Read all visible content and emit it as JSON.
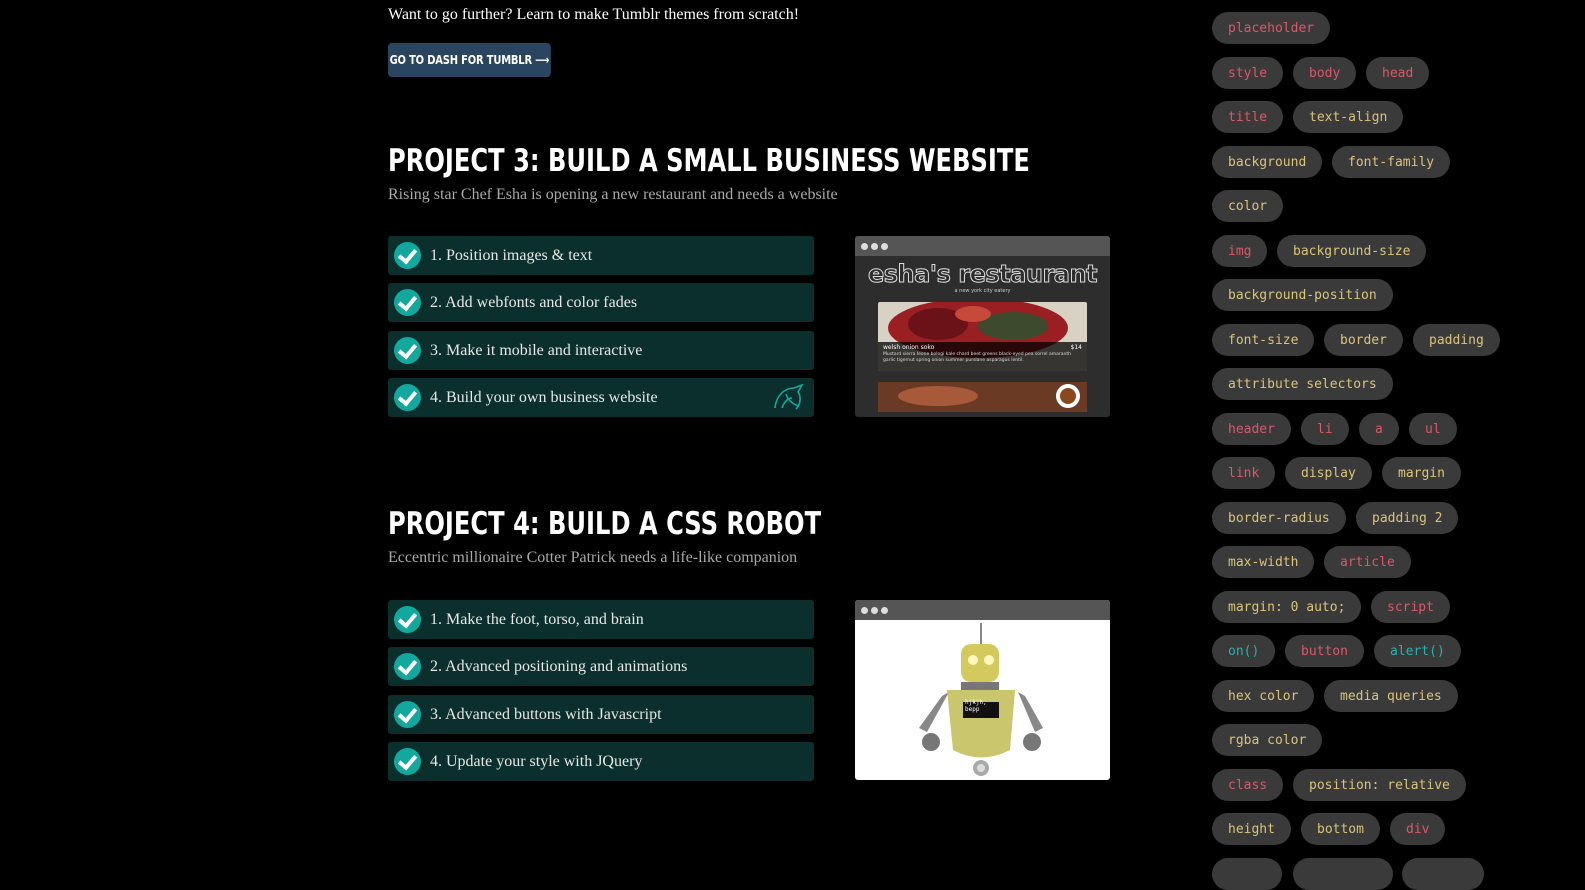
{
  "intro_text": "Want to go further? Learn to make Tumblr themes from scratch!",
  "dash_button": "GO TO DASH FOR TUMBLR ⟶",
  "projects": [
    {
      "title": "PROJECT 3: BUILD A SMALL BUSINESS WEBSITE",
      "subtitle": "Rising star Chef Esha is opening a new restaurant and needs a website",
      "lessons": [
        "1. Position images & text",
        "2. Add webfonts and color fades",
        "3. Make it mobile and interactive",
        "4. Build your own business website"
      ],
      "preview": {
        "heading": "esha's restaurant",
        "tagline": "a new york city eatery",
        "dish": "welsh onion soko",
        "price": "$14",
        "desc": "Mustard sierra leone bologi kale chard beet greens black-eyed pea sorrel amaranth garlic tigernut spring onion summer purslane asparagus lentil."
      }
    },
    {
      "title": "PROJECT 4: BUILD A CSS ROBOT",
      "subtitle": "Eccentric millionaire Cotter Patrick needs a life-like companion",
      "lessons": [
        "1. Make the foot, torso, and brain",
        "2. Advanced positioning and animations",
        "3. Advanced buttons with Javascript",
        "4. Update your style with JQuery"
      ],
      "preview": {
        "screen_text": "hjkjh, bepp"
      }
    }
  ],
  "tags": [
    {
      "label": "placeholder",
      "color": "red"
    },
    {
      "label": "style",
      "color": "red"
    },
    {
      "label": "body",
      "color": "red"
    },
    {
      "label": "head",
      "color": "red"
    },
    {
      "label": "title",
      "color": "red"
    },
    {
      "label": "text-align",
      "color": "yellow"
    },
    {
      "label": "background",
      "color": "yellow"
    },
    {
      "label": "font-family",
      "color": "yellow"
    },
    {
      "label": "color",
      "color": "yellow"
    },
    {
      "label": "img",
      "color": "red"
    },
    {
      "label": "background-size",
      "color": "yellow"
    },
    {
      "label": "background-position",
      "color": "yellow"
    },
    {
      "label": "font-size",
      "color": "yellow"
    },
    {
      "label": "border",
      "color": "yellow"
    },
    {
      "label": "padding",
      "color": "yellow"
    },
    {
      "label": "attribute selectors",
      "color": "yellow"
    },
    {
      "label": "header",
      "color": "red"
    },
    {
      "label": "li",
      "color": "red"
    },
    {
      "label": "a",
      "color": "red"
    },
    {
      "label": "ul",
      "color": "red"
    },
    {
      "label": "link",
      "color": "red"
    },
    {
      "label": "display",
      "color": "yellow"
    },
    {
      "label": "margin",
      "color": "yellow"
    },
    {
      "label": "border-radius",
      "color": "yellow"
    },
    {
      "label": "padding 2",
      "color": "yellow"
    },
    {
      "label": "max-width",
      "color": "yellow"
    },
    {
      "label": "article",
      "color": "red"
    },
    {
      "label": "margin: 0 auto;",
      "color": "yellow"
    },
    {
      "label": "script",
      "color": "red"
    },
    {
      "label": "on()",
      "color": "teal"
    },
    {
      "label": "button",
      "color": "red"
    },
    {
      "label": "alert()",
      "color": "teal"
    },
    {
      "label": "hex color",
      "color": "yellow"
    },
    {
      "label": "media queries",
      "color": "yellow"
    },
    {
      "label": "rgba color",
      "color": "yellow"
    },
    {
      "label": "class",
      "color": "red"
    },
    {
      "label": "position: relative",
      "color": "yellow"
    },
    {
      "label": "height",
      "color": "yellow"
    },
    {
      "label": "bottom",
      "color": "yellow"
    },
    {
      "label": "div",
      "color": "red"
    }
  ]
}
